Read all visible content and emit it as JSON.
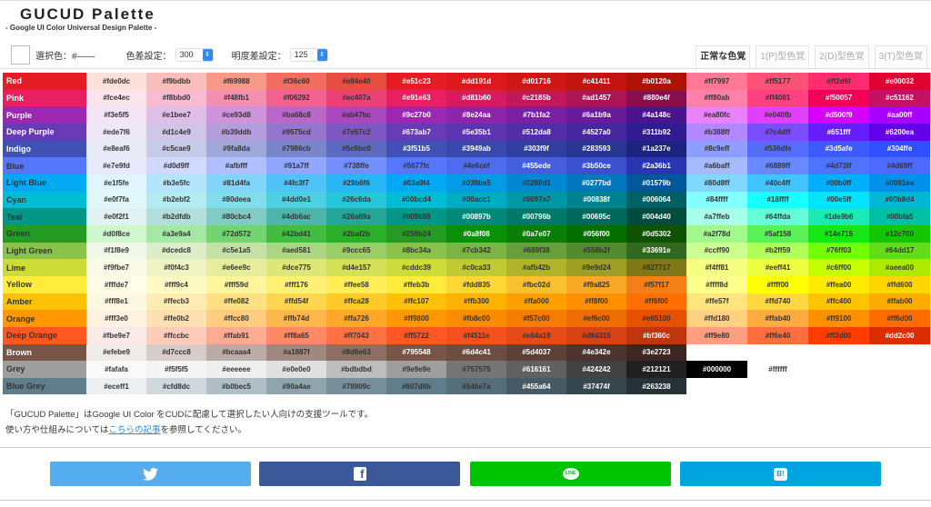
{
  "header": {
    "title": "GUCUD Palette",
    "subtitle": "- Google UI Color Universal Design Palette -"
  },
  "controls": {
    "selected_label": "選択色：#――",
    "color_diff_label": "色差設定：",
    "color_diff_value": "300",
    "brightness_diff_label": "明度差設定：",
    "brightness_diff_value": "125"
  },
  "tabs": [
    "正常な色覚",
    "1(P)型色覚",
    "2(D)型色覚",
    "3(T)型色覚"
  ],
  "rows": [
    {
      "name": "Red",
      "shades": [
        "#fde0dc",
        "#f9bdbb",
        "#f69988",
        "#f36c60",
        "#e84e40",
        "#e51c23",
        "#dd191d",
        "#d01716",
        "#c41411",
        "#b0120a"
      ],
      "accents": [
        "#ff7997",
        "#ff5177",
        "#ff2d6f",
        "#e00032"
      ]
    },
    {
      "name": "Pink",
      "shades": [
        "#fce4ec",
        "#f8bbd0",
        "#f48fb1",
        "#f06292",
        "#ec407a",
        "#e91e63",
        "#d81b60",
        "#c2185b",
        "#ad1457",
        "#880e4f"
      ],
      "accents": [
        "#ff80ab",
        "#ff4081",
        "#f50057",
        "#c51162"
      ]
    },
    {
      "name": "Purple",
      "shades": [
        "#f3e5f5",
        "#e1bee7",
        "#ce93d8",
        "#ba68c8",
        "#ab47bc",
        "#9c27b0",
        "#8e24aa",
        "#7b1fa2",
        "#6a1b9a",
        "#4a148c"
      ],
      "accents": [
        "#ea80fc",
        "#e040fb",
        "#d500f9",
        "#aa00ff"
      ]
    },
    {
      "name": "Deep Purple",
      "shades": [
        "#ede7f6",
        "#d1c4e9",
        "#b39ddb",
        "#9575cd",
        "#7e57c2",
        "#673ab7",
        "#5e35b1",
        "#512da8",
        "#4527a0",
        "#311b92"
      ],
      "accents": [
        "#b388ff",
        "#7c4dff",
        "#651fff",
        "#6200ea"
      ]
    },
    {
      "name": "Indigo",
      "shades": [
        "#e8eaf6",
        "#c5cae9",
        "#9fa8da",
        "#7986cb",
        "#5c6bc0",
        "#3f51b5",
        "#3949ab",
        "#303f9f",
        "#283593",
        "#1a237e"
      ],
      "accents": [
        "#8c9eff",
        "#536dfe",
        "#3d5afe",
        "#304ffe"
      ]
    },
    {
      "name": "Blue",
      "shades": [
        "#e7e9fd",
        "#d0d9ff",
        "#afbfff",
        "#91a7ff",
        "#738ffe",
        "#5677fc",
        "#4e6cef",
        "#455ede",
        "#3b50ce",
        "#2a36b1"
      ],
      "accents": [
        "#a6baff",
        "#6889ff",
        "#4d73ff",
        "#4d69ff"
      ]
    },
    {
      "name": "Light Blue",
      "shades": [
        "#e1f5fe",
        "#b3e5fc",
        "#81d4fa",
        "#4fc3f7",
        "#29b6f6",
        "#03a9f4",
        "#039be5",
        "#0288d1",
        "#0277bd",
        "#01579b"
      ],
      "accents": [
        "#80d8ff",
        "#40c4ff",
        "#00b0ff",
        "#0091ea"
      ]
    },
    {
      "name": "Cyan",
      "shades": [
        "#e0f7fa",
        "#b2ebf2",
        "#80deea",
        "#4dd0e1",
        "#26c6da",
        "#00bcd4",
        "#00acc1",
        "#0097a7",
        "#00838f",
        "#006064"
      ],
      "accents": [
        "#84ffff",
        "#18ffff",
        "#00e5ff",
        "#00b8d4"
      ]
    },
    {
      "name": "Teal",
      "shades": [
        "#e0f2f1",
        "#b2dfdb",
        "#80cbc4",
        "#4db6ac",
        "#26a69a",
        "#009688",
        "#00897b",
        "#00796b",
        "#00695c",
        "#004d40"
      ],
      "accents": [
        "#a7ffeb",
        "#64ffda",
        "#1de9b6",
        "#00bfa5"
      ]
    },
    {
      "name": "Green",
      "shades": [
        "#d0f8ce",
        "#a3e9a4",
        "#72d572",
        "#42bd41",
        "#2baf2b",
        "#259b24",
        "#0a8f08",
        "#0a7e07",
        "#056f00",
        "#0d5302"
      ],
      "accents": [
        "#a2f78d",
        "#5af158",
        "#14e715",
        "#12c700"
      ]
    },
    {
      "name": "Light Green",
      "shades": [
        "#f1f8e9",
        "#dcedc8",
        "#c5e1a5",
        "#aed581",
        "#9ccc65",
        "#8bc34a",
        "#7cb342",
        "#689f38",
        "#558b2f",
        "#33691e"
      ],
      "accents": [
        "#ccff90",
        "#b2ff59",
        "#76ff03",
        "#64dd17"
      ]
    },
    {
      "name": "Lime",
      "shades": [
        "#f9fbe7",
        "#f0f4c3",
        "#e6ee9c",
        "#dce775",
        "#d4e157",
        "#cddc39",
        "#c0ca33",
        "#afb42b",
        "#9e9d24",
        "#827717"
      ],
      "accents": [
        "#f4ff81",
        "#eeff41",
        "#c6ff00",
        "#aeea00"
      ]
    },
    {
      "name": "Yellow",
      "shades": [
        "#fffde7",
        "#fff9c4",
        "#fff59d",
        "#fff176",
        "#ffee58",
        "#ffeb3b",
        "#fdd835",
        "#fbc02d",
        "#f9a825",
        "#f57f17"
      ],
      "accents": [
        "#ffff8d",
        "#ffff00",
        "#ffea00",
        "#ffd600"
      ]
    },
    {
      "name": "Amber",
      "shades": [
        "#fff8e1",
        "#ffecb3",
        "#ffe082",
        "#ffd54f",
        "#ffca28",
        "#ffc107",
        "#ffb300",
        "#ffa000",
        "#ff8f00",
        "#ff6f00"
      ],
      "accents": [
        "#ffe57f",
        "#ffd740",
        "#ffc400",
        "#ffab00"
      ]
    },
    {
      "name": "Orange",
      "shades": [
        "#fff3e0",
        "#ffe0b2",
        "#ffcc80",
        "#ffb74d",
        "#ffa726",
        "#ff9800",
        "#fb8c00",
        "#f57c00",
        "#ef6c00",
        "#e65100"
      ],
      "accents": [
        "#ffd180",
        "#ffab40",
        "#ff9100",
        "#ff6d00"
      ]
    },
    {
      "name": "Deep Orange",
      "shades": [
        "#fbe9e7",
        "#ffccbc",
        "#ffab91",
        "#ff8a65",
        "#ff7043",
        "#ff5722",
        "#f4511e",
        "#e64a19",
        "#d84315",
        "#bf360c"
      ],
      "accents": [
        "#ff9e80",
        "#ff6e40",
        "#ff3d00",
        "#dd2c00"
      ]
    },
    {
      "name": "Brown",
      "shades": [
        "#efebe9",
        "#d7ccc8",
        "#bcaaa4",
        "#a1887f",
        "#8d6e63",
        "#795548",
        "#6d4c41",
        "#5d4037",
        "#4e342e",
        "#3e2723"
      ],
      "accents": []
    },
    {
      "name": "Grey",
      "shades": [
        "#fafafa",
        "#f5f5f5",
        "#eeeeee",
        "#e0e0e0",
        "#bdbdbd",
        "#9e9e9e",
        "#757575",
        "#616161",
        "#424242",
        "#212121"
      ],
      "accents": [
        "#000000",
        "#ffffff"
      ]
    },
    {
      "name": "Blue Grey",
      "shades": [
        "#eceff1",
        "#cfd8dc",
        "#b0bec5",
        "#90a4ae",
        "#78909c",
        "#607d8b",
        "#546e7a",
        "#455a64",
        "#37474f",
        "#263238"
      ],
      "accents": []
    }
  ],
  "white_text": [
    "Red",
    "Pink",
    "Purple",
    "Deep Purple",
    "Indigo",
    "Brown",
    "#e51c23",
    "#dd191d",
    "#d01716",
    "#c41411",
    "#b0120a",
    "#e00032",
    "#e91e63",
    "#d81b60",
    "#c2185b",
    "#ad1457",
    "#880e4f",
    "#f50057",
    "#c51162",
    "#9c27b0",
    "#8e24aa",
    "#7b1fa2",
    "#6a1b9a",
    "#4a148c",
    "#d500f9",
    "#aa00ff",
    "#673ab7",
    "#5e35b1",
    "#512da8",
    "#4527a0",
    "#311b92",
    "#651fff",
    "#6200ea",
    "#3f51b5",
    "#3949ab",
    "#303f9f",
    "#283593",
    "#1a237e",
    "#3d5afe",
    "#304ffe",
    "#455ede",
    "#3b50ce",
    "#2a36b1",
    "#0277bd",
    "#01579b",
    "#00838f",
    "#006064",
    "#00897b",
    "#00796b",
    "#00695c",
    "#004d40",
    "#0a8f08",
    "#0a7e07",
    "#056f00",
    "#0d5302",
    "#33691e",
    "#bf360c",
    "#dd2c00",
    "#795548",
    "#6d4c41",
    "#5d4037",
    "#4e342e",
    "#3e2723",
    "#616161",
    "#424242",
    "#212121",
    "#000000",
    "#455a64",
    "#37474f",
    "#263238"
  ],
  "description": {
    "line1": "「GUCUD Palette」はGoogle UI Color をCUDに配慮して選択したい人向けの支援ツールです。",
    "line2_pre": "使い方や仕組みについては",
    "line2_link": "こちらの記事",
    "line2_post": "を参照してください。"
  },
  "share": {
    "line_label": "LINE",
    "hatena_label": "B!",
    "facebook_label": "f"
  },
  "colors": {
    "twitter": "#55acee",
    "facebook": "#3b5998",
    "line": "#00c300",
    "hatena": "#00a4de"
  }
}
